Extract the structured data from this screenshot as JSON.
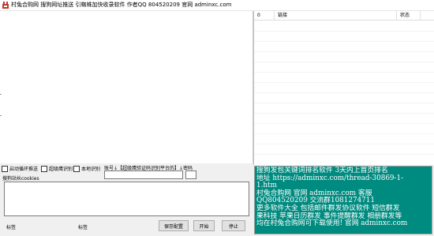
{
  "window": {
    "title": "村兔合购网 搜狗网址推送 引蜘蛛加快收录软件 作者QQ 804520209 官网 adminxc.com"
  },
  "table": {
    "headers": [
      "0",
      "链接",
      "状态"
    ]
  },
  "options": {
    "auto_loop": "启动循环推送",
    "super_captcha": "超级鹰识别",
    "local_captcha": "本地识别"
  },
  "account": {
    "label": "账号↓【超级鹰验证码识别平台的】↓密码"
  },
  "cookie": {
    "label": "搜狗站长cookies"
  },
  "ad": {
    "lines": [
      "搜狗发包关键词排名软件 3天内上首页排名",
      " 地址 https://adminxc.com/thread-30869-1-",
      "1.htm",
      "   村兔合购网 官网 adminxc.com 客服",
      "QQ804520209  交流群1081274711",
      "更多软件大全 包括邮件群发协议软件  短信群发",
      "果科技 苹果日历群发 事件提醒群发 相册群发等",
      "均在村兔合购网可下载使用! 官网 adminxc.com"
    ]
  },
  "statusbar": {
    "label1": "标签",
    "label2": "标签"
  },
  "buttons": {
    "save": "保存配置",
    "start": "开始",
    "stop": "停止"
  },
  "colors": {
    "ad_background": "#008b80",
    "ad_text": "#ffffff"
  }
}
